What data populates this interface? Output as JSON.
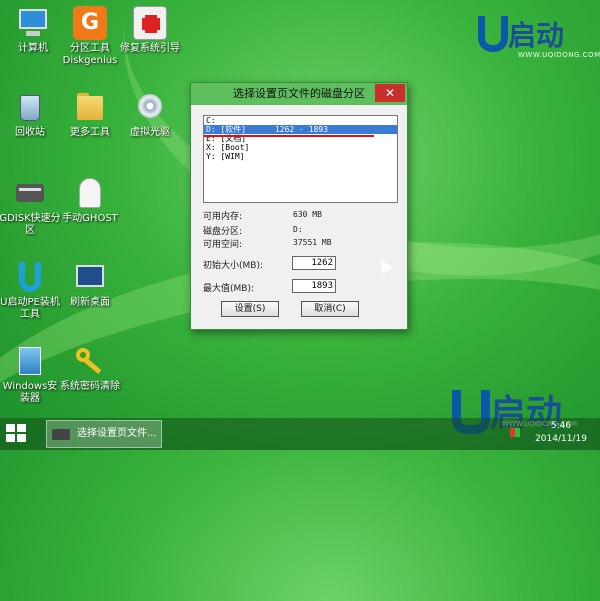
{
  "desktop": {
    "icons": [
      {
        "label": "计算机"
      },
      {
        "label": "分区工具\nDiskgenius"
      },
      {
        "label": "修复系统引导"
      },
      {
        "label": "回收站"
      },
      {
        "label": "更多工具"
      },
      {
        "label": "虚拟光驱"
      },
      {
        "label": "GDISK快速分区"
      },
      {
        "label": "手动GHOST"
      },
      {
        "label": "U启动PE装机工具"
      },
      {
        "label": "刷新桌面"
      },
      {
        "label": "Windows安装器"
      },
      {
        "label": "系统密码清除"
      }
    ],
    "partition_icon_glyph": "G"
  },
  "brand": {
    "name": "启动",
    "url": "WWW.UQIDONG.COM"
  },
  "dialog": {
    "title": "选择设置页文件的磁盘分区",
    "close": "✕",
    "list": [
      "C:",
      "D: [软件]      1262 - 1893",
      "E: [文档]",
      "X: [Boot]",
      "Y: [WIM]"
    ],
    "selected_index": 1,
    "info": {
      "memory_label": "可用内存:",
      "memory_value": "630 MB",
      "partition_label": "磁盘分区:",
      "partition_value": "D:",
      "space_label": "可用空间:",
      "space_value": "37551 MB"
    },
    "initial_label": "初始大小(MB):",
    "initial_value": "1262",
    "max_label": "最大值(MB):",
    "max_value": "1893",
    "ok_button": "设置(S)",
    "cancel_button": "取消(C)"
  },
  "taskbar": {
    "task_label": "选择设置页文件...",
    "time": "5:46",
    "date": "2014/11/19"
  }
}
